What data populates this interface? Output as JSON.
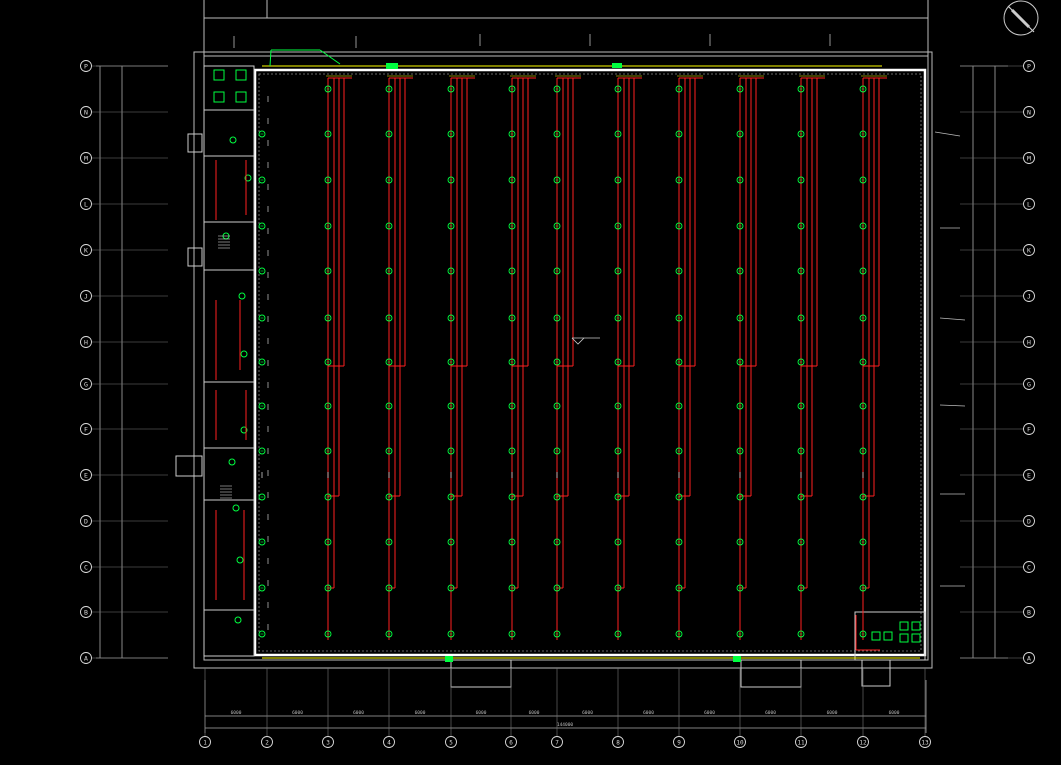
{
  "drawing": {
    "row_axes": [
      "P",
      "N",
      "M",
      "L",
      "K",
      "J",
      "H",
      "G",
      "F",
      "E",
      "D",
      "C",
      "B",
      "A"
    ],
    "column_axes": [
      "1",
      "2",
      "3",
      "4",
      "5",
      "6",
      "7",
      "8",
      "9",
      "10",
      "11",
      "12",
      "13"
    ],
    "overall_dimension": "144000",
    "bay_dimension": "6000",
    "north_arrow": "north-arrow-icon",
    "colors": {
      "background": "#000000",
      "structure": "#ffffff",
      "lighting_circuit": "#ff2020",
      "sprinkler_device": "#00ff40",
      "annotation": "#ffff00"
    }
  }
}
